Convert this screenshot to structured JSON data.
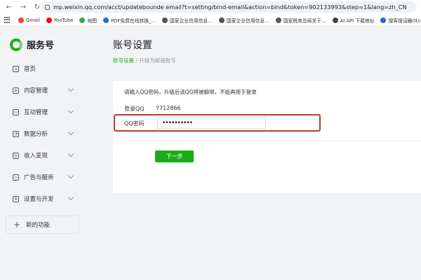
{
  "browser": {
    "url": "mp.weixin.qq.com/acct/updatebounde email?t=setting/bind-email&action=bind&token=902133993&step=1&lang=zh_CN",
    "bookmarks": [
      {
        "label": "Gmail",
        "color": "#ea4335"
      },
      {
        "label": "YouTube",
        "color": "#ff0000"
      },
      {
        "label": "地图",
        "color": "#34a853"
      },
      {
        "label": "PDF免费在线转换_...",
        "color": "#1a73e8"
      },
      {
        "label": "国家企业信用信息...",
        "color": "#555555"
      },
      {
        "label": "国家企业信用信息...",
        "color": "#555555"
      },
      {
        "label": "国家税务总局关于...",
        "color": "#555555"
      },
      {
        "label": "AI API 下载地址",
        "color": "#444444"
      },
      {
        "label": "搜客搜词器(ttci.co...",
        "color": "#3b5bdb"
      }
    ]
  },
  "sidebar": {
    "brand": "服务号",
    "items": [
      {
        "label": "首页",
        "icon": "home-icon",
        "glyph": "⌂",
        "chevron": false
      },
      {
        "label": "内容管理",
        "icon": "document-icon",
        "glyph": "≡",
        "chevron": true
      },
      {
        "label": "互动管理",
        "icon": "chat-icon",
        "glyph": "▭",
        "chevron": true
      },
      {
        "label": "数据分析",
        "icon": "chart-icon",
        "glyph": "◔",
        "chevron": true
      },
      {
        "label": "收入变现",
        "icon": "coin-icon",
        "glyph": "◎",
        "chevron": true
      },
      {
        "label": "广告与服务",
        "icon": "compass-icon",
        "glyph": "◇",
        "chevron": true
      },
      {
        "label": "设置与开发",
        "icon": "gear-icon",
        "glyph": "✲",
        "chevron": true
      }
    ],
    "new_feature": "新的功能"
  },
  "main": {
    "title": "账号设置",
    "breadcrumb_link": "账号设置",
    "breadcrumb_sep": " / ",
    "breadcrumb_current": "升级为邮箱账号",
    "hint": "请输入QQ密码，升级后该QQ将被解绑，不能再用于登录",
    "qq_label": "登录QQ",
    "qq_value": "7712866",
    "pwd_label": "QQ密码",
    "pwd_value": "••••••••••",
    "next_button": "下一步"
  },
  "colors": {
    "accent": "#1aad19",
    "highlight": "#c0392b"
  }
}
